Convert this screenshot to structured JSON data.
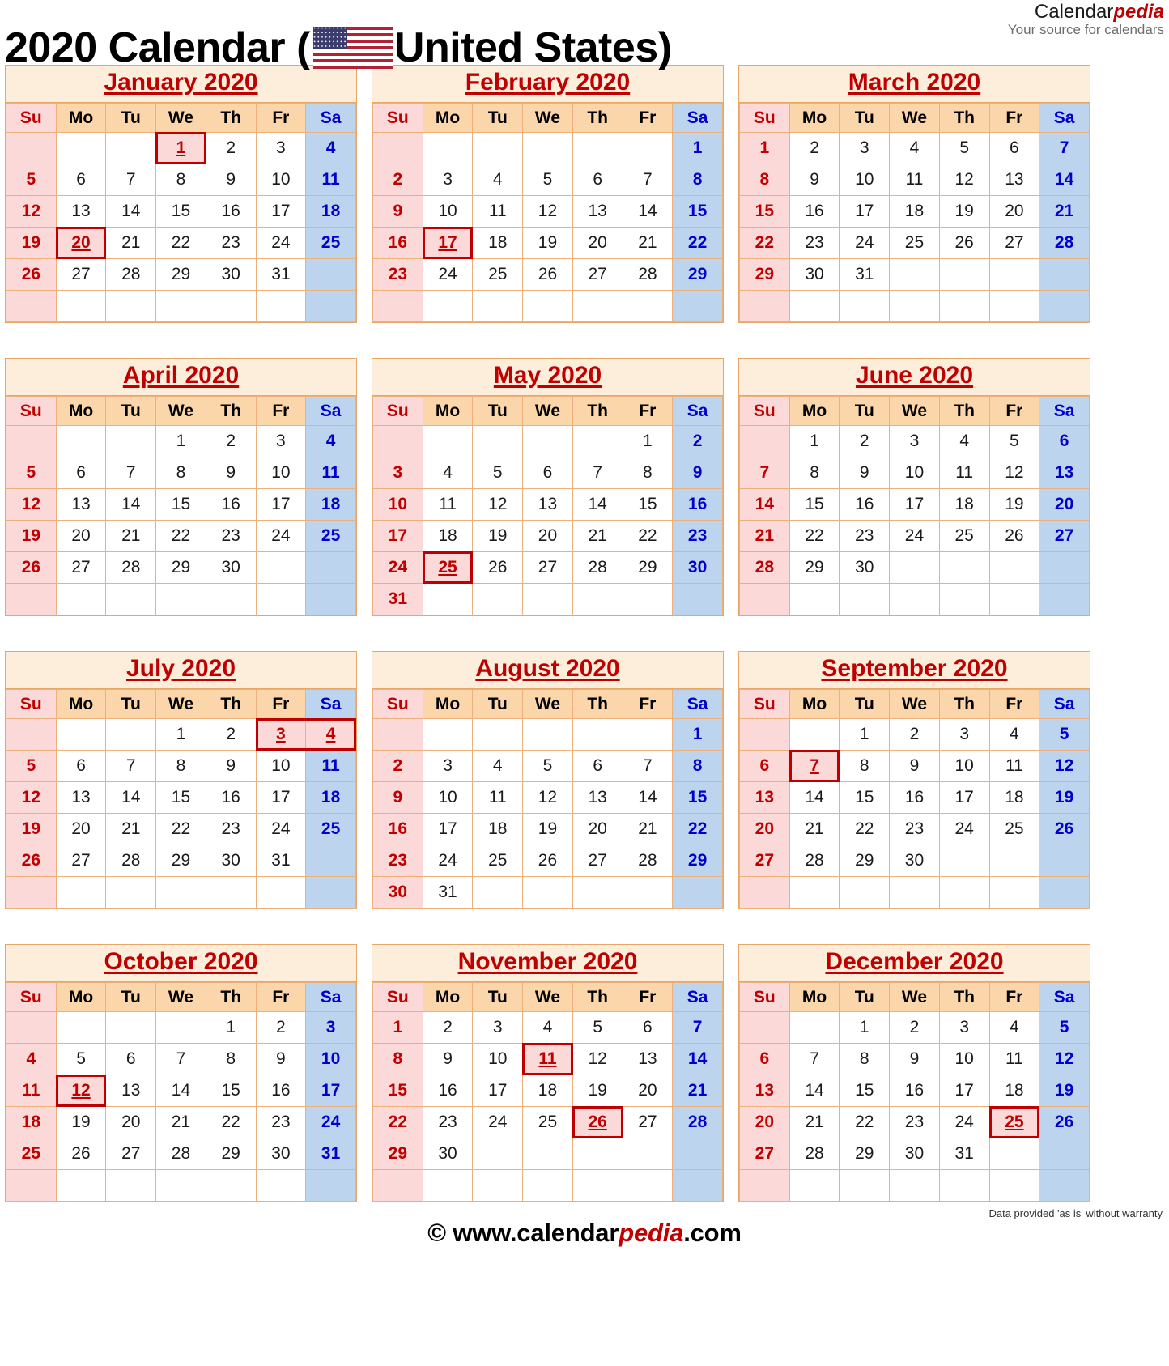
{
  "header": {
    "title_pre": "2020 Calendar (",
    "title_post": "United States)",
    "flag_icon": "us-flag-icon",
    "brand_name_plain": "Calendar",
    "brand_name_accent": "pedia",
    "brand_tagline": "Your source for calendars"
  },
  "colors": {
    "accent_red": "#c00000",
    "saturday_blue": "#0000cd",
    "sunday_bg": "#fbd9d9",
    "saturday_bg": "#bdd4ee",
    "weekday_header_bg": "#fbd6ab",
    "month_title_bg": "#fdeedc",
    "grid_border": "#edb07a",
    "holiday_border": "#c00000"
  },
  "weekday_headers": [
    "Su",
    "Mo",
    "Tu",
    "We",
    "Th",
    "Fr",
    "Sa"
  ],
  "year": "2020",
  "country": "United States",
  "months": [
    {
      "name": "January 2020",
      "weeks": [
        [
          "",
          "",
          "",
          "1",
          "2",
          "3",
          "4"
        ],
        [
          "5",
          "6",
          "7",
          "8",
          "9",
          "10",
          "11"
        ],
        [
          "12",
          "13",
          "14",
          "15",
          "16",
          "17",
          "18"
        ],
        [
          "19",
          "20",
          "21",
          "22",
          "23",
          "24",
          "25"
        ],
        [
          "26",
          "27",
          "28",
          "29",
          "30",
          "31",
          ""
        ],
        [
          "",
          "",
          "",
          "",
          "",
          "",
          ""
        ]
      ],
      "holidays": [
        "1",
        "20"
      ]
    },
    {
      "name": "February 2020",
      "weeks": [
        [
          "",
          "",
          "",
          "",
          "",
          "",
          "1"
        ],
        [
          "2",
          "3",
          "4",
          "5",
          "6",
          "7",
          "8"
        ],
        [
          "9",
          "10",
          "11",
          "12",
          "13",
          "14",
          "15"
        ],
        [
          "16",
          "17",
          "18",
          "19",
          "20",
          "21",
          "22"
        ],
        [
          "23",
          "24",
          "25",
          "26",
          "27",
          "28",
          "29"
        ],
        [
          "",
          "",
          "",
          "",
          "",
          "",
          ""
        ]
      ],
      "holidays": [
        "17"
      ]
    },
    {
      "name": "March 2020",
      "weeks": [
        [
          "1",
          "2",
          "3",
          "4",
          "5",
          "6",
          "7"
        ],
        [
          "8",
          "9",
          "10",
          "11",
          "12",
          "13",
          "14"
        ],
        [
          "15",
          "16",
          "17",
          "18",
          "19",
          "20",
          "21"
        ],
        [
          "22",
          "23",
          "24",
          "25",
          "26",
          "27",
          "28"
        ],
        [
          "29",
          "30",
          "31",
          "",
          "",
          "",
          ""
        ],
        [
          "",
          "",
          "",
          "",
          "",
          "",
          ""
        ]
      ],
      "holidays": []
    },
    {
      "name": "April 2020",
      "weeks": [
        [
          "",
          "",
          "",
          "1",
          "2",
          "3",
          "4"
        ],
        [
          "5",
          "6",
          "7",
          "8",
          "9",
          "10",
          "11"
        ],
        [
          "12",
          "13",
          "14",
          "15",
          "16",
          "17",
          "18"
        ],
        [
          "19",
          "20",
          "21",
          "22",
          "23",
          "24",
          "25"
        ],
        [
          "26",
          "27",
          "28",
          "29",
          "30",
          "",
          ""
        ],
        [
          "",
          "",
          "",
          "",
          "",
          "",
          ""
        ]
      ],
      "holidays": []
    },
    {
      "name": "May 2020",
      "weeks": [
        [
          "",
          "",
          "",
          "",
          "",
          "1",
          "2"
        ],
        [
          "3",
          "4",
          "5",
          "6",
          "7",
          "8",
          "9"
        ],
        [
          "10",
          "11",
          "12",
          "13",
          "14",
          "15",
          "16"
        ],
        [
          "17",
          "18",
          "19",
          "20",
          "21",
          "22",
          "23"
        ],
        [
          "24",
          "25",
          "26",
          "27",
          "28",
          "29",
          "30"
        ],
        [
          "31",
          "",
          "",
          "",
          "",
          "",
          ""
        ]
      ],
      "holidays": [
        "25"
      ]
    },
    {
      "name": "June 2020",
      "weeks": [
        [
          "",
          "1",
          "2",
          "3",
          "4",
          "5",
          "6"
        ],
        [
          "7",
          "8",
          "9",
          "10",
          "11",
          "12",
          "13"
        ],
        [
          "14",
          "15",
          "16",
          "17",
          "18",
          "19",
          "20"
        ],
        [
          "21",
          "22",
          "23",
          "24",
          "25",
          "26",
          "27"
        ],
        [
          "28",
          "29",
          "30",
          "",
          "",
          "",
          ""
        ],
        [
          "",
          "",
          "",
          "",
          "",
          "",
          ""
        ]
      ],
      "holidays": []
    },
    {
      "name": "July 2020",
      "weeks": [
        [
          "",
          "",
          "",
          "1",
          "2",
          "3",
          "4"
        ],
        [
          "5",
          "6",
          "7",
          "8",
          "9",
          "10",
          "11"
        ],
        [
          "12",
          "13",
          "14",
          "15",
          "16",
          "17",
          "18"
        ],
        [
          "19",
          "20",
          "21",
          "22",
          "23",
          "24",
          "25"
        ],
        [
          "26",
          "27",
          "28",
          "29",
          "30",
          "31",
          ""
        ],
        [
          "",
          "",
          "",
          "",
          "",
          "",
          ""
        ]
      ],
      "holidays": [
        "3",
        "4"
      ]
    },
    {
      "name": "August 2020",
      "weeks": [
        [
          "",
          "",
          "",
          "",
          "",
          "",
          "1"
        ],
        [
          "2",
          "3",
          "4",
          "5",
          "6",
          "7",
          "8"
        ],
        [
          "9",
          "10",
          "11",
          "12",
          "13",
          "14",
          "15"
        ],
        [
          "16",
          "17",
          "18",
          "19",
          "20",
          "21",
          "22"
        ],
        [
          "23",
          "24",
          "25",
          "26",
          "27",
          "28",
          "29"
        ],
        [
          "30",
          "31",
          "",
          "",
          "",
          "",
          ""
        ]
      ],
      "holidays": []
    },
    {
      "name": "September 2020",
      "weeks": [
        [
          "",
          "",
          "1",
          "2",
          "3",
          "4",
          "5"
        ],
        [
          "6",
          "7",
          "8",
          "9",
          "10",
          "11",
          "12"
        ],
        [
          "13",
          "14",
          "15",
          "16",
          "17",
          "18",
          "19"
        ],
        [
          "20",
          "21",
          "22",
          "23",
          "24",
          "25",
          "26"
        ],
        [
          "27",
          "28",
          "29",
          "30",
          "",
          "",
          ""
        ],
        [
          "",
          "",
          "",
          "",
          "",
          "",
          ""
        ]
      ],
      "holidays": [
        "7"
      ]
    },
    {
      "name": "October 2020",
      "weeks": [
        [
          "",
          "",
          "",
          "",
          "1",
          "2",
          "3"
        ],
        [
          "4",
          "5",
          "6",
          "7",
          "8",
          "9",
          "10"
        ],
        [
          "11",
          "12",
          "13",
          "14",
          "15",
          "16",
          "17"
        ],
        [
          "18",
          "19",
          "20",
          "21",
          "22",
          "23",
          "24"
        ],
        [
          "25",
          "26",
          "27",
          "28",
          "29",
          "30",
          "31"
        ],
        [
          "",
          "",
          "",
          "",
          "",
          "",
          ""
        ]
      ],
      "holidays": [
        "12"
      ]
    },
    {
      "name": "November 2020",
      "weeks": [
        [
          "1",
          "2",
          "3",
          "4",
          "5",
          "6",
          "7"
        ],
        [
          "8",
          "9",
          "10",
          "11",
          "12",
          "13",
          "14"
        ],
        [
          "15",
          "16",
          "17",
          "18",
          "19",
          "20",
          "21"
        ],
        [
          "22",
          "23",
          "24",
          "25",
          "26",
          "27",
          "28"
        ],
        [
          "29",
          "30",
          "",
          "",
          "",
          "",
          ""
        ],
        [
          "",
          "",
          "",
          "",
          "",
          "",
          ""
        ]
      ],
      "holidays": [
        "11",
        "26"
      ]
    },
    {
      "name": "December 2020",
      "weeks": [
        [
          "",
          "",
          "1",
          "2",
          "3",
          "4",
          "5"
        ],
        [
          "6",
          "7",
          "8",
          "9",
          "10",
          "11",
          "12"
        ],
        [
          "13",
          "14",
          "15",
          "16",
          "17",
          "18",
          "19"
        ],
        [
          "20",
          "21",
          "22",
          "23",
          "24",
          "25",
          "26"
        ],
        [
          "27",
          "28",
          "29",
          "30",
          "31",
          "",
          ""
        ],
        [
          "",
          "",
          "",
          "",
          "",
          "",
          ""
        ]
      ],
      "holidays": [
        "25"
      ]
    }
  ],
  "footer": {
    "copyright_pre": "© www.calendar",
    "copyright_accent": "pedia",
    "copyright_post": ".com",
    "disclaimer": "Data provided 'as is' without warranty"
  }
}
